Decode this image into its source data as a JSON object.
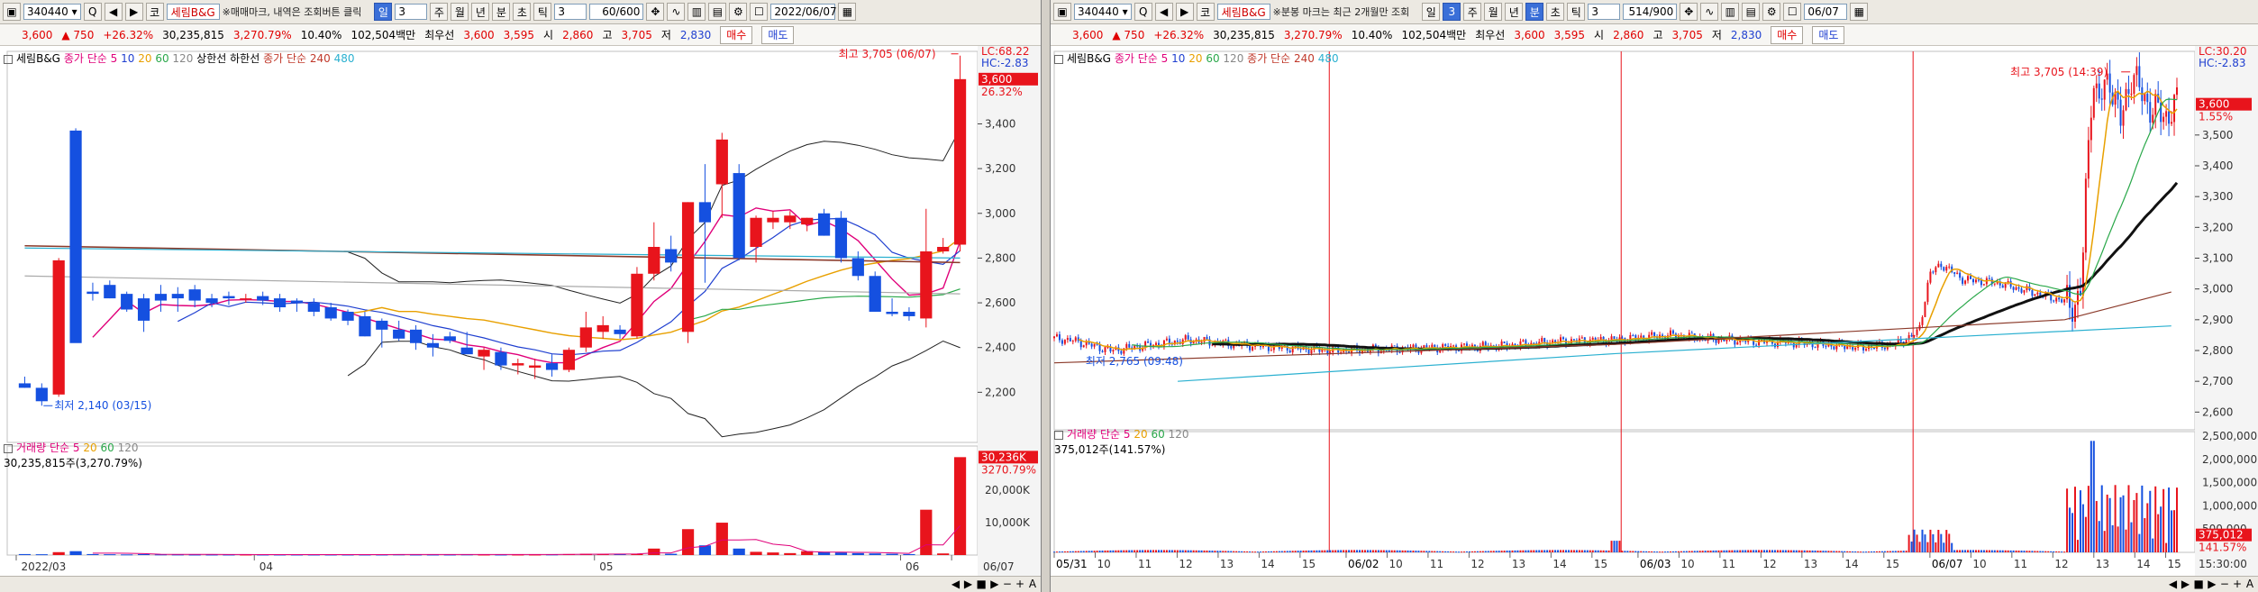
{
  "left": {
    "toolbar": {
      "code": "340440",
      "code_arrow": "▾",
      "q_label": "Q",
      "nav_icons": [
        "◀",
        "▶"
      ],
      "market_label": "코",
      "name": "세림B&G",
      "note": "※매매마크, 내역은 조회버튼 클릭",
      "period_buttons": [
        {
          "label": "일",
          "active": true
        },
        {
          "label": "3",
          "active": false
        },
        {
          "label": "주",
          "active": false
        },
        {
          "label": "월",
          "active": false
        },
        {
          "label": "년",
          "active": false
        },
        {
          "label": "분",
          "active": false
        },
        {
          "label": "초",
          "active": false
        },
        {
          "label": "틱",
          "active": false
        }
      ],
      "interval_value": "3",
      "count_value": "60/600",
      "date_value": "2022/06/07"
    },
    "quote": {
      "price": "3,600",
      "arrow": "▲",
      "change": "750",
      "change_pct": "+26.32%",
      "volume": "30,235,815",
      "volume_pct": "3,270.79%",
      "turnover": "10.40%",
      "amount": "102,504백만",
      "best_label": "최우선",
      "ask": "3,600",
      "bid": "3,595",
      "open_label": "시",
      "open": "2,860",
      "high_label": "고",
      "high": "3,705",
      "low_label": "저",
      "low": "2,830",
      "buy": "매수",
      "sell": "매도"
    },
    "legend": {
      "name": "세림B&G",
      "ma_label": "종가 단순",
      "ma_periods": [
        "5",
        "10",
        "20",
        "60",
        "120"
      ],
      "ma_colors": [
        "#e0007a",
        "#1f3fd0",
        "#e8a000",
        "#2aa84a",
        "#888888"
      ],
      "limit_up": "상한선",
      "limit_down": "하한선",
      "ma240_label": "종가 단순 240",
      "ma240_extra": "480"
    },
    "vol_legend": {
      "label": "거래량",
      "ma_label": "단순",
      "periods": [
        "5",
        "20",
        "60",
        "120"
      ],
      "value_line": "30,235,815주(3,270.79%)"
    },
    "chart_data": {
      "type": "candlestick",
      "period": "daily",
      "y_ticks": [
        "2,200",
        "2,400",
        "2,600",
        "2,800",
        "3,000",
        "3,200",
        "3,400"
      ],
      "y_range": [
        2000,
        3700
      ],
      "x_labels": [
        {
          "label": "2022/03",
          "index": 0
        },
        {
          "label": "04",
          "index": 14
        },
        {
          "label": "05",
          "index": 34
        },
        {
          "label": "06",
          "index": 52
        },
        {
          "label": "06/07",
          "index": 55
        }
      ],
      "candles": [
        {
          "o": 2240,
          "h": 2270,
          "l": 2220,
          "c": 2220
        },
        {
          "o": 2220,
          "h": 2240,
          "l": 2140,
          "c": 2160
        },
        {
          "o": 2190,
          "h": 2800,
          "l": 2180,
          "c": 2790
        },
        {
          "o": 3370,
          "h": 3380,
          "l": 2700,
          "c": 2420
        },
        {
          "o": 2650,
          "h": 2690,
          "l": 2610,
          "c": 2640
        },
        {
          "o": 2680,
          "h": 2700,
          "l": 2620,
          "c": 2620
        },
        {
          "o": 2640,
          "h": 2650,
          "l": 2560,
          "c": 2570
        },
        {
          "o": 2620,
          "h": 2640,
          "l": 2470,
          "c": 2520
        },
        {
          "o": 2640,
          "h": 2680,
          "l": 2560,
          "c": 2610
        },
        {
          "o": 2640,
          "h": 2670,
          "l": 2560,
          "c": 2620
        },
        {
          "o": 2660,
          "h": 2680,
          "l": 2580,
          "c": 2610
        },
        {
          "o": 2620,
          "h": 2640,
          "l": 2580,
          "c": 2600
        },
        {
          "o": 2630,
          "h": 2650,
          "l": 2590,
          "c": 2620
        },
        {
          "o": 2620,
          "h": 2640,
          "l": 2600,
          "c": 2620
        },
        {
          "o": 2630,
          "h": 2650,
          "l": 2590,
          "c": 2610
        },
        {
          "o": 2620,
          "h": 2640,
          "l": 2560,
          "c": 2580
        },
        {
          "o": 2610,
          "h": 2620,
          "l": 2560,
          "c": 2600
        },
        {
          "o": 2600,
          "h": 2620,
          "l": 2540,
          "c": 2560
        },
        {
          "o": 2580,
          "h": 2600,
          "l": 2520,
          "c": 2530
        },
        {
          "o": 2560,
          "h": 2570,
          "l": 2500,
          "c": 2520
        },
        {
          "o": 2540,
          "h": 2560,
          "l": 2450,
          "c": 2450
        },
        {
          "o": 2520,
          "h": 2530,
          "l": 2400,
          "c": 2480
        },
        {
          "o": 2480,
          "h": 2520,
          "l": 2430,
          "c": 2440
        },
        {
          "o": 2480,
          "h": 2500,
          "l": 2390,
          "c": 2420
        },
        {
          "o": 2420,
          "h": 2460,
          "l": 2360,
          "c": 2400
        },
        {
          "o": 2450,
          "h": 2470,
          "l": 2420,
          "c": 2430
        },
        {
          "o": 2400,
          "h": 2470,
          "l": 2380,
          "c": 2370
        },
        {
          "o": 2360,
          "h": 2400,
          "l": 2300,
          "c": 2390
        },
        {
          "o": 2380,
          "h": 2400,
          "l": 2300,
          "c": 2320
        },
        {
          "o": 2320,
          "h": 2350,
          "l": 2280,
          "c": 2330
        },
        {
          "o": 2310,
          "h": 2350,
          "l": 2260,
          "c": 2320
        },
        {
          "o": 2330,
          "h": 2370,
          "l": 2270,
          "c": 2300
        },
        {
          "o": 2300,
          "h": 2400,
          "l": 2290,
          "c": 2390
        },
        {
          "o": 2400,
          "h": 2560,
          "l": 2380,
          "c": 2490
        },
        {
          "o": 2470,
          "h": 2540,
          "l": 2440,
          "c": 2500
        },
        {
          "o": 2480,
          "h": 2500,
          "l": 2440,
          "c": 2460
        },
        {
          "o": 2450,
          "h": 2760,
          "l": 2440,
          "c": 2730
        },
        {
          "o": 2730,
          "h": 2960,
          "l": 2700,
          "c": 2850
        },
        {
          "o": 2840,
          "h": 2900,
          "l": 2740,
          "c": 2780
        },
        {
          "o": 2470,
          "h": 3050,
          "l": 2420,
          "c": 3050
        },
        {
          "o": 3050,
          "h": 3220,
          "l": 2690,
          "c": 2960
        },
        {
          "o": 3130,
          "h": 3360,
          "l": 2980,
          "c": 3330
        },
        {
          "o": 3180,
          "h": 3220,
          "l": 2790,
          "c": 2800
        },
        {
          "o": 2850,
          "h": 2990,
          "l": 2780,
          "c": 2980
        },
        {
          "o": 2960,
          "h": 3010,
          "l": 2930,
          "c": 2980
        },
        {
          "o": 2960,
          "h": 3010,
          "l": 2930,
          "c": 2990
        },
        {
          "o": 2950,
          "h": 2980,
          "l": 2920,
          "c": 2980
        },
        {
          "o": 3000,
          "h": 3020,
          "l": 2900,
          "c": 2900
        },
        {
          "o": 2980,
          "h": 3010,
          "l": 2780,
          "c": 2800
        },
        {
          "o": 2800,
          "h": 2830,
          "l": 2700,
          "c": 2720
        },
        {
          "o": 2720,
          "h": 2740,
          "l": 2560,
          "c": 2560
        },
        {
          "o": 2560,
          "h": 2620,
          "l": 2540,
          "c": 2550
        },
        {
          "o": 2560,
          "h": 2580,
          "l": 2520,
          "c": 2540
        },
        {
          "o": 2530,
          "h": 3020,
          "l": 2490,
          "c": 2830
        },
        {
          "o": 2830,
          "h": 2890,
          "l": 2820,
          "c": 2850
        },
        {
          "o": 2860,
          "h": 3705,
          "l": 2830,
          "c": 3600
        }
      ],
      "volume_ticks": [
        "10,000K",
        "20,000K",
        "30,236K"
      ],
      "volume_range": [
        0,
        32000
      ],
      "volumes_k": [
        300,
        250,
        900,
        1200,
        300,
        250,
        200,
        300,
        200,
        180,
        150,
        150,
        150,
        150,
        150,
        150,
        150,
        150,
        150,
        150,
        150,
        150,
        200,
        150,
        150,
        150,
        200,
        150,
        150,
        150,
        150,
        200,
        300,
        400,
        300,
        400,
        300,
        2000,
        400,
        8000,
        3000,
        10000,
        2000,
        1000,
        800,
        600,
        1200,
        1000,
        800,
        600,
        500,
        400,
        300,
        14000,
        500,
        30236
      ],
      "annotations": {
        "high": "최고 3,705 (06/07)",
        "low": "최저 2,140 (03/15)",
        "lc": "LC:68.22",
        "hc": "HC:-2.83",
        "price_tag": "3,600",
        "pct_tag": "26.32%",
        "vol_tag": "30,236K",
        "vol_pct_tag": "3270.79%"
      }
    }
  },
  "right": {
    "toolbar": {
      "code": "340440",
      "code_arrow": "▾",
      "q_label": "Q",
      "nav_icons": [
        "◀",
        "▶"
      ],
      "market_label": "코",
      "name": "세림B&G",
      "note": "※분봉 마크는 최근 2개월만 조회",
      "period_buttons": [
        {
          "label": "일",
          "active": false
        },
        {
          "label": "3",
          "active": true
        },
        {
          "label": "주",
          "active": false
        },
        {
          "label": "월",
          "active": false
        },
        {
          "label": "년",
          "active": false
        },
        {
          "label": "분",
          "active": true
        },
        {
          "label": "초",
          "active": false
        },
        {
          "label": "틱",
          "active": false
        }
      ],
      "interval_value": "3",
      "count_value": "514/900",
      "date_value": "06/07"
    },
    "quote": {
      "price": "3,600",
      "arrow": "▲",
      "change": "750",
      "change_pct": "+26.32%",
      "volume": "30,235,815",
      "volume_pct": "3,270.79%",
      "turnover": "10.40%",
      "amount": "102,504백만",
      "best_label": "최우선",
      "ask": "3,600",
      "bid": "3,595",
      "open_label": "시",
      "open": "2,860",
      "high_label": "고",
      "high": "3,705",
      "low_label": "저",
      "low": "2,830",
      "buy": "매수",
      "sell": "매도"
    },
    "legend": {
      "name": "세림B&G",
      "ma_label": "종가 단순",
      "ma_periods": [
        "5",
        "10",
        "20",
        "60",
        "120"
      ],
      "ma_colors": [
        "#e0007a",
        "#1f3fd0",
        "#e8a000",
        "#2aa84a",
        "#888888"
      ],
      "ma240_label": "종가 단순 240",
      "ma240_extra": "480"
    },
    "vol_legend": {
      "label": "거래량",
      "ma_label": "단순",
      "periods": [
        "5",
        "20",
        "60",
        "120"
      ],
      "value_line": "375,012주(141.57%)"
    },
    "chart_data": {
      "type": "candlestick",
      "period": "3-minute",
      "y_ticks": [
        "2,600",
        "2,700",
        "2,800",
        "2,900",
        "3,000",
        "3,100",
        "3,200",
        "3,300",
        "3,400",
        "3,500"
      ],
      "y_range": [
        2560,
        3760
      ],
      "x_labels": [
        {
          "label": "05/31",
          "session": 0
        },
        {
          "label": "10",
          "session": 0
        },
        {
          "label": "11",
          "session": 0
        },
        {
          "label": "12",
          "session": 0
        },
        {
          "label": "13",
          "session": 0
        },
        {
          "label": "14",
          "session": 0
        },
        {
          "label": "15",
          "session": 0
        },
        {
          "label": "06/02",
          "session": 1
        },
        {
          "label": "10",
          "session": 1
        },
        {
          "label": "11",
          "session": 1
        },
        {
          "label": "12",
          "session": 1
        },
        {
          "label": "13",
          "session": 1
        },
        {
          "label": "14",
          "session": 1
        },
        {
          "label": "15",
          "session": 1
        },
        {
          "label": "06/03",
          "session": 2
        },
        {
          "label": "10",
          "session": 2
        },
        {
          "label": "11",
          "session": 2
        },
        {
          "label": "12",
          "session": 2
        },
        {
          "label": "13",
          "session": 2
        },
        {
          "label": "14",
          "session": 2
        },
        {
          "label": "15",
          "session": 2
        },
        {
          "label": "06/07",
          "session": 3
        },
        {
          "label": "10",
          "session": 3
        },
        {
          "label": "11",
          "session": 3
        },
        {
          "label": "12",
          "session": 3
        },
        {
          "label": "13",
          "session": 3
        },
        {
          "label": "14",
          "session": 3
        },
        {
          "label": "15",
          "session": 3
        },
        {
          "label": "15:30:00",
          "session": 3
        }
      ],
      "price_path": [
        [
          0,
          2840
        ],
        [
          0.02,
          2830
        ],
        [
          0.05,
          2800
        ],
        [
          0.08,
          2815
        ],
        [
          0.12,
          2835
        ],
        [
          0.16,
          2820
        ],
        [
          0.2,
          2810
        ],
        [
          0.25,
          2800
        ],
        [
          0.3,
          2805
        ],
        [
          0.35,
          2810
        ],
        [
          0.4,
          2815
        ],
        [
          0.45,
          2830
        ],
        [
          0.5,
          2835
        ],
        [
          0.53,
          2845
        ],
        [
          0.55,
          2850
        ],
        [
          0.58,
          2840
        ],
        [
          0.62,
          2830
        ],
        [
          0.66,
          2825
        ],
        [
          0.7,
          2815
        ],
        [
          0.72,
          2810
        ],
        [
          0.75,
          2820
        ],
        [
          0.77,
          2860
        ],
        [
          0.78,
          3050
        ],
        [
          0.79,
          3080
        ],
        [
          0.81,
          3030
        ],
        [
          0.84,
          3020
        ],
        [
          0.87,
          2990
        ],
        [
          0.9,
          2960
        ],
        [
          0.91,
          2950
        ],
        [
          0.915,
          3000
        ],
        [
          0.92,
          3400
        ],
        [
          0.925,
          3700
        ],
        [
          0.93,
          3600
        ],
        [
          0.94,
          3690
        ],
        [
          0.95,
          3540
        ],
        [
          0.96,
          3705
        ],
        [
          0.97,
          3620
        ],
        [
          0.98,
          3580
        ],
        [
          0.99,
          3560
        ],
        [
          1.0,
          3600
        ]
      ],
      "volume_ticks": [
        "500,000",
        "1,000,000",
        "1,500,000",
        "2,000,000",
        "2,500,000"
      ],
      "volume_range": [
        0,
        2600000
      ],
      "annotations": {
        "high": "최고 3,705 (14:39)",
        "low": "최저 2,765 (09:48)",
        "lc": "LC:30.20",
        "hc": "HC:-2.83",
        "price_tag": "3,600",
        "pct_tag": "1.55%",
        "vol_tag": "375,012",
        "vol_pct_tag": "141.57%"
      }
    }
  },
  "statusbar": {
    "controls": [
      "◀",
      "▶",
      "■",
      "▶",
      "−",
      "+",
      "A"
    ]
  }
}
